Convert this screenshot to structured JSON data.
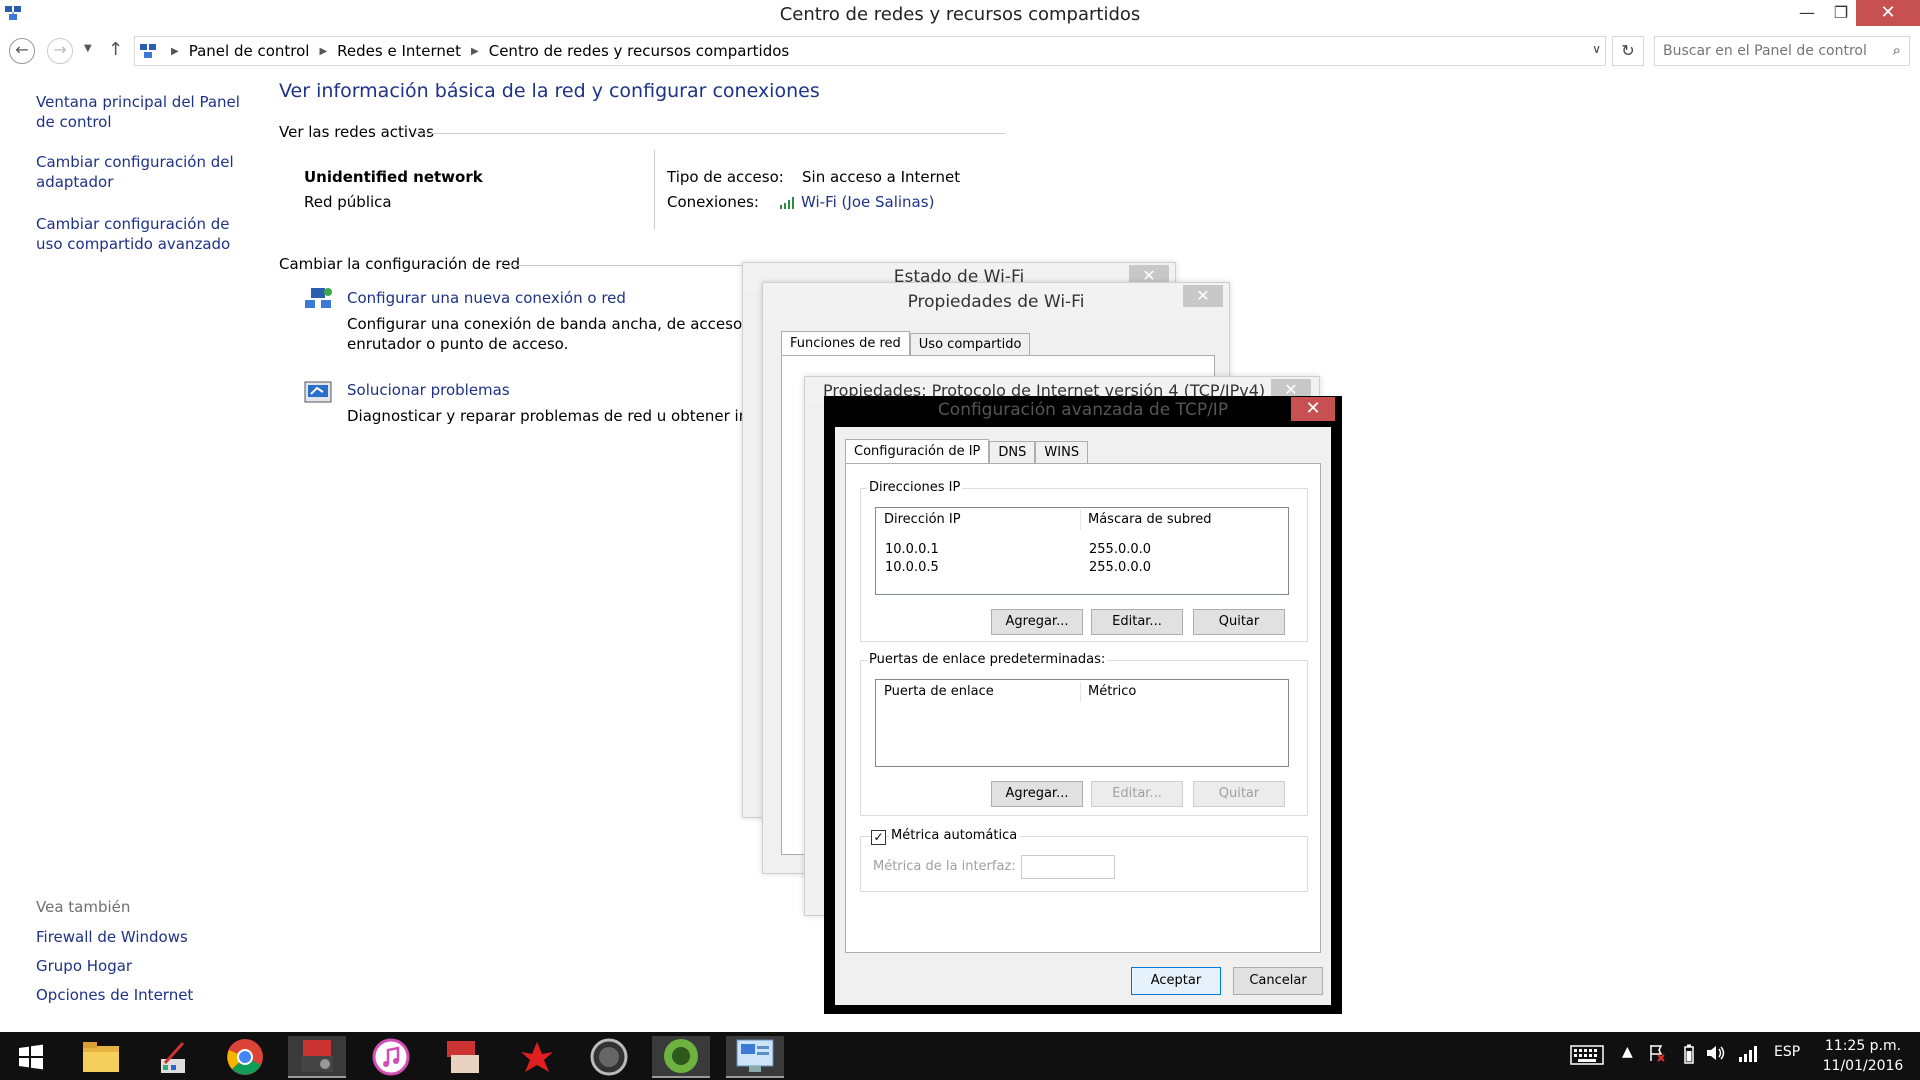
{
  "window": {
    "title": "Centro de redes y recursos compartidos",
    "minimize": "—",
    "maximize": "❐",
    "close": "✕"
  },
  "nav": {
    "crumbs": [
      "Panel de control",
      "Redes e Internet",
      "Centro de redes y recursos compartidos"
    ],
    "search_placeholder": "Buscar en el Panel de control"
  },
  "sidebar": {
    "links": [
      "Ventana principal del Panel de control",
      "Cambiar configuración del adaptador",
      "Cambiar configuración de uso compartido avanzado"
    ],
    "see_also_title": "Vea también",
    "see_also": [
      "Firewall de Windows",
      "Grupo Hogar",
      "Opciones de Internet"
    ]
  },
  "main": {
    "title": "Ver información básica de la red y configurar conexiones",
    "active_networks_head": "Ver las redes activas",
    "network_name": "Unidentified network",
    "network_type": "Red pública",
    "access_label": "Tipo de acceso:",
    "access_value": "Sin acceso a Internet",
    "connections_label": "Conexiones:",
    "connections_value": "Wi-Fi (Joe Salinas)",
    "change_head": "Cambiar la configuración de red",
    "tasks": [
      {
        "title": "Configurar una nueva conexión o red",
        "desc_line1": "Configurar una conexión de banda ancha, de acceso telefón",
        "desc_line2": "enrutador o punto de acceso."
      },
      {
        "title": "Solucionar problemas",
        "desc_line1": "Diagnosticar y reparar problemas de red u obtener informa"
      }
    ]
  },
  "dialogs": {
    "wifi_status_title": "Estado de Wi-Fi",
    "wifi_props_title": "Propiedades de Wi-Fi",
    "wifi_props_tabs": [
      "Funciones de red",
      "Uso compartido"
    ],
    "ipv4_title": "Propiedades: Protocolo de Internet versión 4 (TCP/IPv4)",
    "advanced": {
      "title": "Configuración avanzada de TCP/IP",
      "tabs": [
        "Configuración de IP",
        "DNS",
        "WINS"
      ],
      "ip_group": "Direcciones IP",
      "ip_col1": "Dirección IP",
      "ip_col2": "Máscara de subred",
      "ip_rows": [
        {
          "ip": "10.0.0.1",
          "mask": "255.0.0.0"
        },
        {
          "ip": "10.0.0.5",
          "mask": "255.0.0.0"
        }
      ],
      "add": "Agregar...",
      "edit": "Editar...",
      "remove": "Quitar",
      "gw_group": "Puertas de enlace predeterminadas:",
      "gw_col1": "Puerta de enlace",
      "gw_col2": "Métrico",
      "auto_metric": "Métrica automática",
      "interface_metric": "Métrica de la interfaz:",
      "ok": "Aceptar",
      "cancel": "Cancelar"
    }
  },
  "taskbar": {
    "lang": "ESP",
    "time": "11:25 p.m.",
    "date": "11/01/2016"
  }
}
